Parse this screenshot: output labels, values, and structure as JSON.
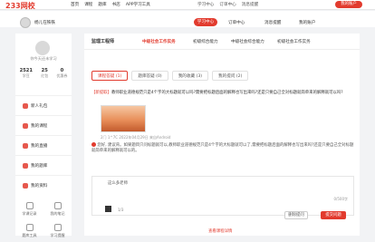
{
  "topbar": {
    "logo": "233网校",
    "nav": [
      "首页",
      "课程",
      "题库",
      "书店",
      "APP学习工具"
    ],
    "links": [
      "学习中心",
      "订单中心",
      "消息提醒"
    ],
    "account": "我的账户"
  },
  "subbar": {
    "username": "杨儿在铁铁",
    "study_center": "学习中心",
    "nav": [
      "订单中心",
      "消息提醒",
      "我的账户"
    ]
  },
  "left": {
    "tagline": "你今天还未学习",
    "stats": [
      {
        "num": "2521",
        "label": "学豆"
      },
      {
        "num": "25",
        "label": "红包"
      },
      {
        "num": "0",
        "label": "优惠券"
      }
    ],
    "menu": [
      "新人礼包",
      "我的课程",
      "我的直播",
      "我的题库",
      "我的资料"
    ],
    "tools": [
      "学课记录",
      "我的笔记",
      "题库工具",
      "学习提醒"
    ]
  },
  "main": {
    "selector": "监理工程师",
    "course_tabs": [
      "中级社会工作实务",
      "初级综合能力",
      "中级社会综合能力",
      "初级社会工作实务"
    ],
    "tabs": [
      "课程答疑 (1)",
      "题库答疑 (0)",
      "我的收藏 (3)",
      "我的提问 (2)"
    ],
    "question": {
      "tag": "【新提取】",
      "text": "教师职业道德规范只是4个字的大标题就可以吗?需要把标题后面的解释也写出来吗?还是只要自己全对标题就简单来的解释就可以吗?",
      "meta": "2门  1^7C  2022年04月29日  来自Android"
    },
    "answer": {
      "text": "您好, 建议背。如果题目只问标题就可以,教师职业道德规范只是4个字的大标题就可以了,需要把标题后面的解释也写出来吗?还是只要自己全对标题就简单来的解释就可以的。"
    },
    "editor": {
      "placeholder": "这么多老师",
      "counter": "0/500字",
      "pager": "1/3",
      "clear_label": "删除提问",
      "submit_label": "提交问题"
    },
    "more_label": "查看课程详情"
  }
}
